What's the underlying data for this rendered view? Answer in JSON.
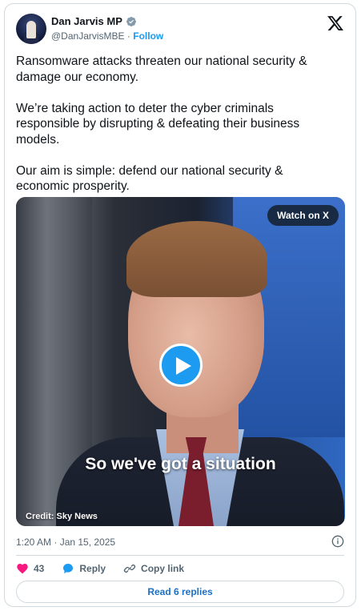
{
  "author": {
    "name": "Dan Jarvis MP",
    "handle": "@DanJarvisMBE",
    "separator": "·",
    "follow_label": "Follow"
  },
  "tweet_text": {
    "p1": "Ransomware attacks threaten our national security & damage our economy.",
    "p2": "We’re taking action to deter the cyber criminals responsible by disrupting & defeating their business models.",
    "p3": "Our aim is simple: defend our national security & economic prosperity."
  },
  "media": {
    "watch_label": "Watch on X",
    "caption": "So we've got a situation",
    "credit": "Credit: Sky News"
  },
  "meta": {
    "timestamp": "1:20 AM · Jan 15, 2025"
  },
  "actions": {
    "likes": "43",
    "reply_label": "Reply",
    "copy_label": "Copy link"
  },
  "read_replies_label": "Read 6 replies",
  "colors": {
    "accent": "#1d9bf0",
    "heart": "#f91880",
    "muted": "#536471"
  }
}
